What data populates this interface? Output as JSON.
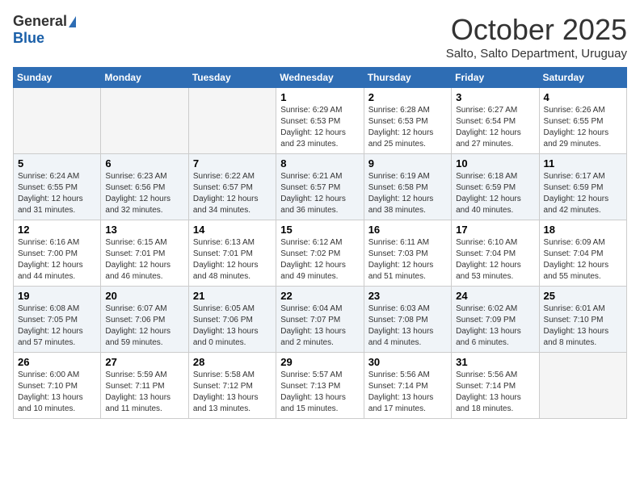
{
  "header": {
    "logo_general": "General",
    "logo_blue": "Blue",
    "month_title": "October 2025",
    "location": "Salto, Salto Department, Uruguay"
  },
  "days_of_week": [
    "Sunday",
    "Monday",
    "Tuesday",
    "Wednesday",
    "Thursday",
    "Friday",
    "Saturday"
  ],
  "weeks": [
    {
      "shaded": false,
      "days": [
        {
          "num": "",
          "info": ""
        },
        {
          "num": "",
          "info": ""
        },
        {
          "num": "",
          "info": ""
        },
        {
          "num": "1",
          "info": "Sunrise: 6:29 AM\nSunset: 6:53 PM\nDaylight: 12 hours\nand 23 minutes."
        },
        {
          "num": "2",
          "info": "Sunrise: 6:28 AM\nSunset: 6:53 PM\nDaylight: 12 hours\nand 25 minutes."
        },
        {
          "num": "3",
          "info": "Sunrise: 6:27 AM\nSunset: 6:54 PM\nDaylight: 12 hours\nand 27 minutes."
        },
        {
          "num": "4",
          "info": "Sunrise: 6:26 AM\nSunset: 6:55 PM\nDaylight: 12 hours\nand 29 minutes."
        }
      ]
    },
    {
      "shaded": true,
      "days": [
        {
          "num": "5",
          "info": "Sunrise: 6:24 AM\nSunset: 6:55 PM\nDaylight: 12 hours\nand 31 minutes."
        },
        {
          "num": "6",
          "info": "Sunrise: 6:23 AM\nSunset: 6:56 PM\nDaylight: 12 hours\nand 32 minutes."
        },
        {
          "num": "7",
          "info": "Sunrise: 6:22 AM\nSunset: 6:57 PM\nDaylight: 12 hours\nand 34 minutes."
        },
        {
          "num": "8",
          "info": "Sunrise: 6:21 AM\nSunset: 6:57 PM\nDaylight: 12 hours\nand 36 minutes."
        },
        {
          "num": "9",
          "info": "Sunrise: 6:19 AM\nSunset: 6:58 PM\nDaylight: 12 hours\nand 38 minutes."
        },
        {
          "num": "10",
          "info": "Sunrise: 6:18 AM\nSunset: 6:59 PM\nDaylight: 12 hours\nand 40 minutes."
        },
        {
          "num": "11",
          "info": "Sunrise: 6:17 AM\nSunset: 6:59 PM\nDaylight: 12 hours\nand 42 minutes."
        }
      ]
    },
    {
      "shaded": false,
      "days": [
        {
          "num": "12",
          "info": "Sunrise: 6:16 AM\nSunset: 7:00 PM\nDaylight: 12 hours\nand 44 minutes."
        },
        {
          "num": "13",
          "info": "Sunrise: 6:15 AM\nSunset: 7:01 PM\nDaylight: 12 hours\nand 46 minutes."
        },
        {
          "num": "14",
          "info": "Sunrise: 6:13 AM\nSunset: 7:01 PM\nDaylight: 12 hours\nand 48 minutes."
        },
        {
          "num": "15",
          "info": "Sunrise: 6:12 AM\nSunset: 7:02 PM\nDaylight: 12 hours\nand 49 minutes."
        },
        {
          "num": "16",
          "info": "Sunrise: 6:11 AM\nSunset: 7:03 PM\nDaylight: 12 hours\nand 51 minutes."
        },
        {
          "num": "17",
          "info": "Sunrise: 6:10 AM\nSunset: 7:04 PM\nDaylight: 12 hours\nand 53 minutes."
        },
        {
          "num": "18",
          "info": "Sunrise: 6:09 AM\nSunset: 7:04 PM\nDaylight: 12 hours\nand 55 minutes."
        }
      ]
    },
    {
      "shaded": true,
      "days": [
        {
          "num": "19",
          "info": "Sunrise: 6:08 AM\nSunset: 7:05 PM\nDaylight: 12 hours\nand 57 minutes."
        },
        {
          "num": "20",
          "info": "Sunrise: 6:07 AM\nSunset: 7:06 PM\nDaylight: 12 hours\nand 59 minutes."
        },
        {
          "num": "21",
          "info": "Sunrise: 6:05 AM\nSunset: 7:06 PM\nDaylight: 13 hours\nand 0 minutes."
        },
        {
          "num": "22",
          "info": "Sunrise: 6:04 AM\nSunset: 7:07 PM\nDaylight: 13 hours\nand 2 minutes."
        },
        {
          "num": "23",
          "info": "Sunrise: 6:03 AM\nSunset: 7:08 PM\nDaylight: 13 hours\nand 4 minutes."
        },
        {
          "num": "24",
          "info": "Sunrise: 6:02 AM\nSunset: 7:09 PM\nDaylight: 13 hours\nand 6 minutes."
        },
        {
          "num": "25",
          "info": "Sunrise: 6:01 AM\nSunset: 7:10 PM\nDaylight: 13 hours\nand 8 minutes."
        }
      ]
    },
    {
      "shaded": false,
      "days": [
        {
          "num": "26",
          "info": "Sunrise: 6:00 AM\nSunset: 7:10 PM\nDaylight: 13 hours\nand 10 minutes."
        },
        {
          "num": "27",
          "info": "Sunrise: 5:59 AM\nSunset: 7:11 PM\nDaylight: 13 hours\nand 11 minutes."
        },
        {
          "num": "28",
          "info": "Sunrise: 5:58 AM\nSunset: 7:12 PM\nDaylight: 13 hours\nand 13 minutes."
        },
        {
          "num": "29",
          "info": "Sunrise: 5:57 AM\nSunset: 7:13 PM\nDaylight: 13 hours\nand 15 minutes."
        },
        {
          "num": "30",
          "info": "Sunrise: 5:56 AM\nSunset: 7:14 PM\nDaylight: 13 hours\nand 17 minutes."
        },
        {
          "num": "31",
          "info": "Sunrise: 5:56 AM\nSunset: 7:14 PM\nDaylight: 13 hours\nand 18 minutes."
        },
        {
          "num": "",
          "info": ""
        }
      ]
    }
  ]
}
